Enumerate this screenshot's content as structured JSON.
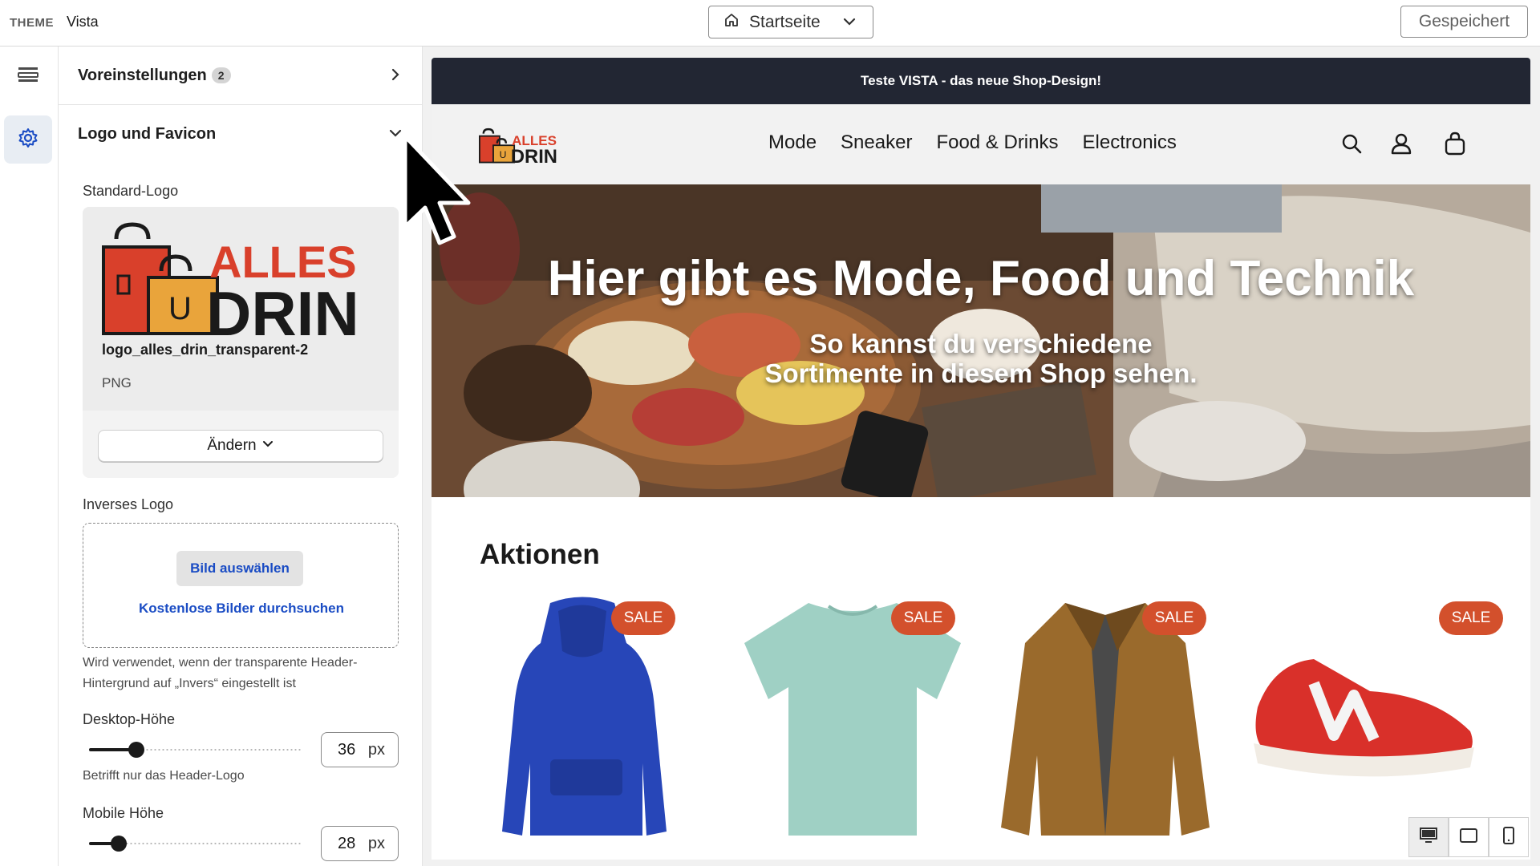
{
  "topbar": {
    "theme_label": "THEME",
    "theme_name": "Vista",
    "page_select": "Startseite",
    "saved_label": "Gespeichert"
  },
  "panel": {
    "presets": {
      "title": "Voreinstellungen",
      "count": "2"
    },
    "logo_section": {
      "title": "Logo und Favicon"
    },
    "standard_logo": {
      "label": "Standard-Logo",
      "file_name": "logo_alles_drin_transparent-2",
      "file_type": "PNG",
      "change_label": "Ändern"
    },
    "inverse_logo": {
      "label": "Inverses Logo",
      "choose_label": "Bild auswählen",
      "browse_label": "Kostenlose Bilder durchsuchen",
      "hint": "Wird verwendet, wenn der transparente Header-Hintergrund auf „Invers“ eingestellt ist"
    },
    "desktop_height": {
      "label": "Desktop-Höhe",
      "value": "36",
      "unit": "px",
      "hint": "Betrifft nur das Header-Logo",
      "level": 0.22
    },
    "mobile_height": {
      "label": "Mobile Höhe",
      "value": "28",
      "unit": "px",
      "level": 0.14
    }
  },
  "logo": {
    "line1": "ALLES",
    "line2": "DRIN",
    "bag_letter": "U"
  },
  "preview": {
    "announcement": "Teste VISTA - das neue Shop-Design!",
    "nav": [
      "Mode",
      "Sneaker",
      "Food & Drinks",
      "Electronics"
    ],
    "hero_title": "Hier gibt es Mode, Food und Technik",
    "hero_subtitle": "So kannst du verschiedene Sortimente in diesem Shop sehen.",
    "section_title": "Aktionen",
    "sale_badge": "SALE",
    "products": [
      "blue-hoodie",
      "mint-tshirt",
      "brown-jacket",
      "red-sneaker"
    ]
  },
  "colors": {
    "accent": "#1a4cc4",
    "sale": "#d3502c",
    "announce_bg": "#222633",
    "logo_red": "#d9402b",
    "logo_orange": "#e9a43b"
  }
}
